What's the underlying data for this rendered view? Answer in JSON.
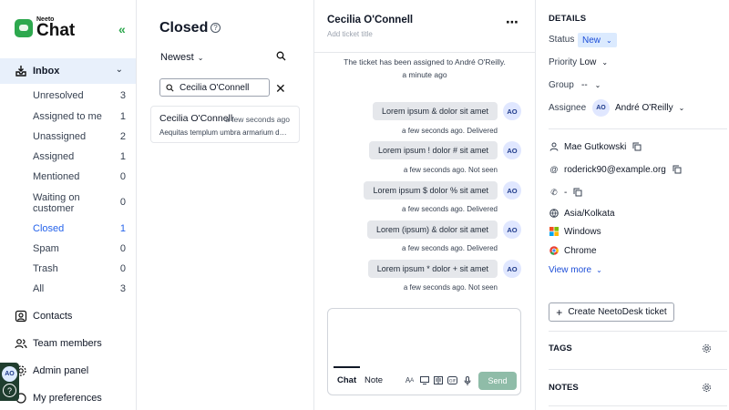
{
  "brand": {
    "small": "Neeto",
    "big": "Chat"
  },
  "sidebar": {
    "inbox_label": "Inbox",
    "inbox_items": [
      {
        "label": "Unresolved",
        "count": "3"
      },
      {
        "label": "Assigned to me",
        "count": "1"
      },
      {
        "label": "Unassigned",
        "count": "2"
      },
      {
        "label": "Assigned",
        "count": "1"
      },
      {
        "label": "Mentioned",
        "count": "0"
      },
      {
        "label": "Waiting on customer",
        "count": "0"
      },
      {
        "label": "Closed",
        "count": "1"
      },
      {
        "label": "Spam",
        "count": "0"
      },
      {
        "label": "Trash",
        "count": "0"
      },
      {
        "label": "All",
        "count": "3"
      }
    ],
    "nav": [
      {
        "label": "Contacts"
      },
      {
        "label": "Team members"
      },
      {
        "label": "Admin panel"
      },
      {
        "label": "My preferences"
      }
    ],
    "user_initials": "AO"
  },
  "list": {
    "title": "Closed",
    "sort_label": "Newest",
    "search_value": "Cecilia O'Connell",
    "conversations": [
      {
        "name": "Cecilia O'Connell",
        "time": "a few seconds ago",
        "preview": "Aequitas templum umbra armarium debitis"
      }
    ]
  },
  "conversation": {
    "name": "Cecilia O'Connell",
    "subtitle": "Add ticket title",
    "system_message": "The ticket has been assigned to André O'Reilly.",
    "system_time": "a minute ago",
    "messages": [
      {
        "text": "Lorem ipsum & dolor sit amet",
        "avatar": "AO",
        "meta": "a few seconds ago. Delivered"
      },
      {
        "text": "Lorem ipsum ! dolor # sit amet",
        "avatar": "AO",
        "meta": "a few seconds ago. Not seen"
      },
      {
        "text": "Lorem ipsum $ dolor % sit amet",
        "avatar": "AO",
        "meta": "a few seconds ago. Delivered"
      },
      {
        "text": "Lorem (ipsum) & dolor sit amet",
        "avatar": "AO",
        "meta": "a few seconds ago. Delivered"
      },
      {
        "text": "Lorem ipsum * dolor + sit amet",
        "avatar": "AO",
        "meta": "a few seconds ago. Not seen"
      }
    ],
    "composer": {
      "tab_chat": "Chat",
      "tab_note": "Note",
      "send_label": "Send"
    }
  },
  "details": {
    "title": "DETAILS",
    "status_label": "Status",
    "status_value": "New",
    "priority_label": "Priority",
    "priority_value": "Low",
    "group_label": "Group",
    "group_value": "--",
    "assignee_label": "Assignee",
    "assignee_initials": "AO",
    "assignee_value": "André O'Reilly",
    "contact_name": "Mae Gutkowski",
    "contact_email": "roderick90@example.org",
    "contact_phone": "-",
    "timezone": "Asia/Kolkata",
    "os": "Windows",
    "browser": "Chrome",
    "view_more": "View more",
    "create_ticket": "Create NeetoDesk ticket",
    "tags_title": "TAGS",
    "notes_title": "NOTES"
  },
  "colors": {
    "brand_green": "#2da84e",
    "active_blue": "#2563eb",
    "inbox_bg": "#e8f0fb",
    "send_bg": "#8fbca8"
  }
}
